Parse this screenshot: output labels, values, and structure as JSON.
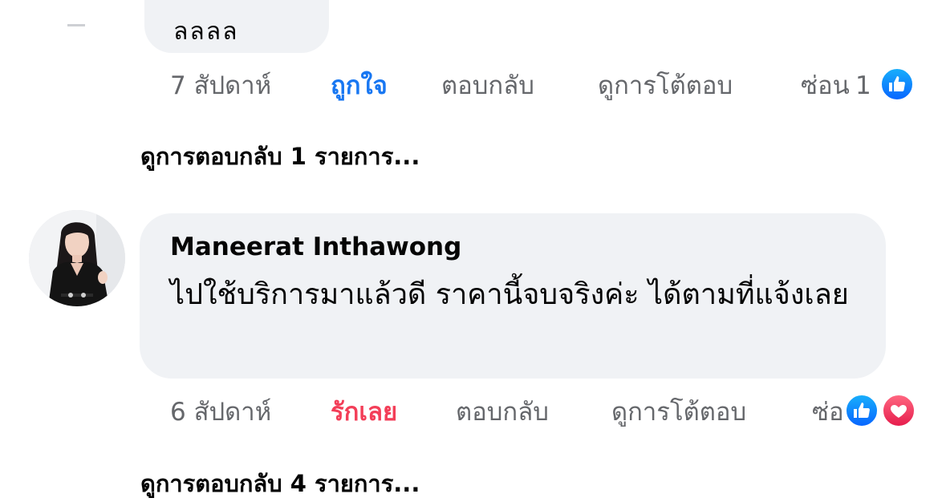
{
  "previous_comment": {
    "cut_text": "ลลลล",
    "time": "7 สัปดาห์",
    "like_label": "ถูกใจ",
    "reply_label": "ตอบกลับ",
    "view_reactions_label": "ดูการโต้ตอบ",
    "hide_label": "ซ่อน",
    "reaction_count": "1",
    "reactions": [
      "like-icon"
    ],
    "view_replies": "ดูการตอบกลับ 1 รายการ..."
  },
  "comment": {
    "author": "Maneerat Inthawong",
    "text": "ไปใช้บริการมาแล้วดี ราคานี้จบจริงค่ะ ได้ตามที่แจ้งเลย",
    "time": "6 สัปดาห์",
    "love_label": "รักเลย",
    "reply_label": "ตอบกลับ",
    "view_reactions_label": "ดูการโต้ตอบ",
    "hide_label": "ซ่อ",
    "reactions": [
      "like-icon",
      "heart-icon"
    ],
    "view_replies": "ดูการตอบกลับ 4 รายการ..."
  },
  "colors": {
    "like_blue": "#1877f2",
    "love_red": "#f33e58",
    "bubble_bg": "#f0f2f5",
    "secondary_text": "#65676b"
  }
}
